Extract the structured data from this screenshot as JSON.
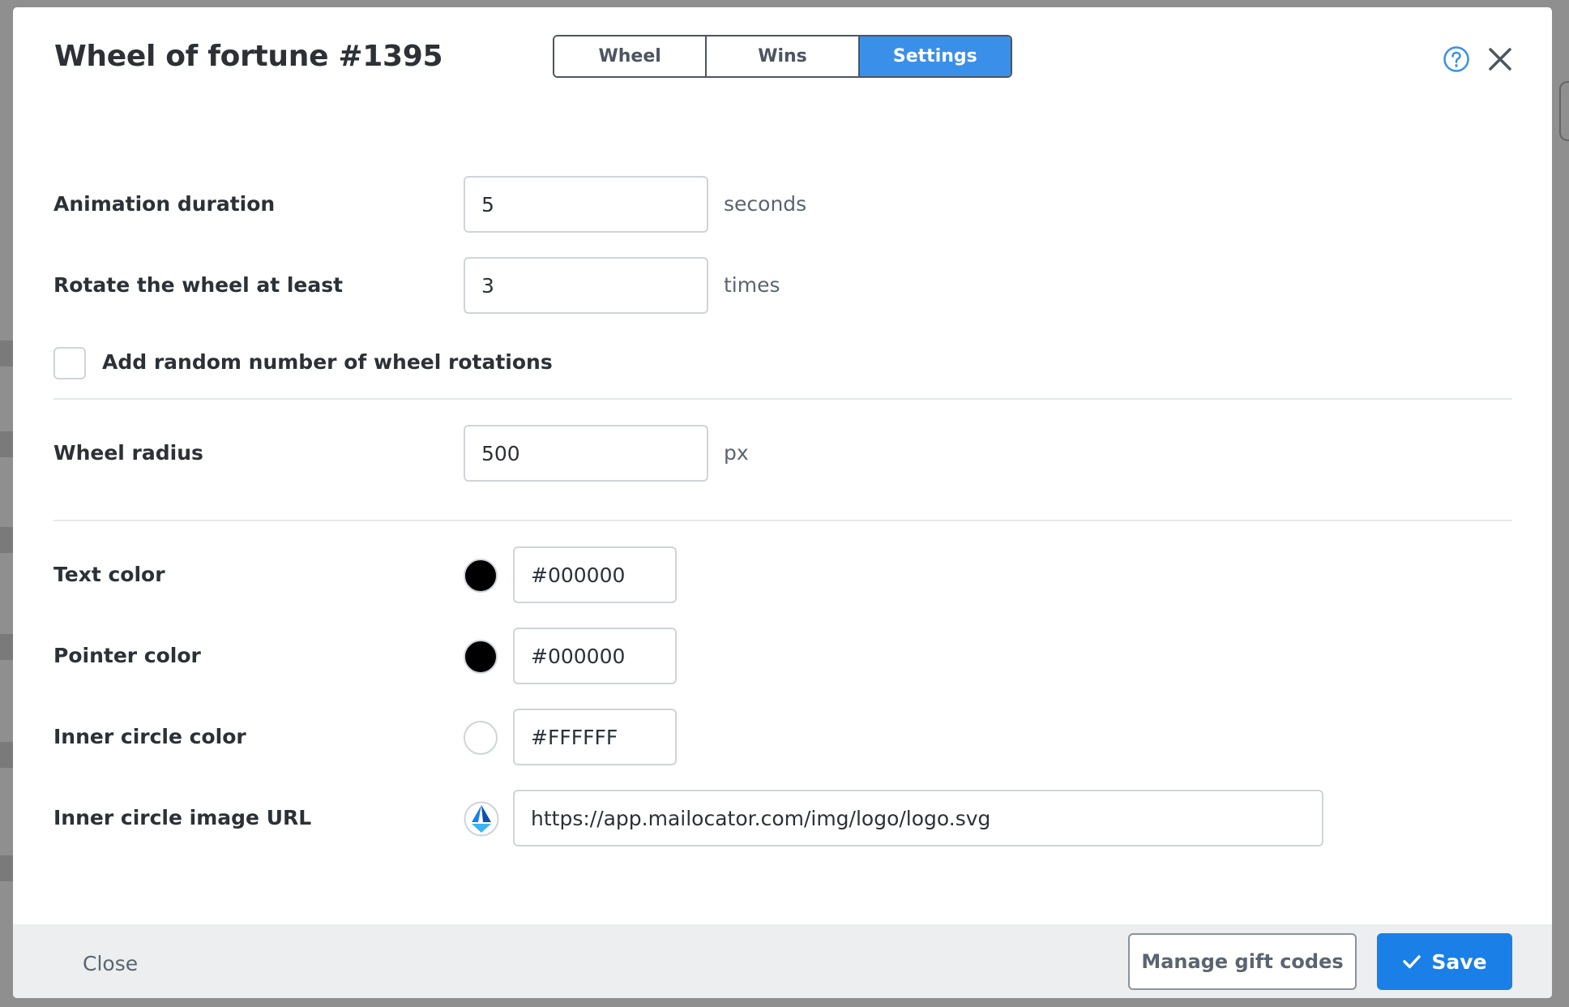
{
  "dialog": {
    "title": "Wheel of fortune #1395",
    "tabs": [
      {
        "label": "Wheel",
        "active": false
      },
      {
        "label": "Wins",
        "active": false
      },
      {
        "label": "Settings",
        "active": true
      }
    ],
    "help_icon": "question-circle-icon",
    "close_icon": "close-x-icon"
  },
  "settings": {
    "animation_duration": {
      "label": "Animation duration",
      "value": "5",
      "unit": "seconds"
    },
    "min_rotations": {
      "label": "Rotate the wheel at least",
      "value": "3",
      "unit": "times"
    },
    "random_rotations": {
      "label": "Add random number of wheel rotations",
      "checked": false
    },
    "wheel_radius": {
      "label": "Wheel radius",
      "value": "500",
      "unit": "px"
    },
    "text_color": {
      "label": "Text color",
      "value": "#000000"
    },
    "pointer_color": {
      "label": "Pointer color",
      "value": "#000000"
    },
    "inner_circle_color": {
      "label": "Inner circle color",
      "value": "#FFFFFF"
    },
    "inner_circle_image": {
      "label": "Inner circle image URL",
      "value": "https://app.mailocator.com/img/logo/logo.svg"
    }
  },
  "footer": {
    "close_label": "Close",
    "manage_label": "Manage gift codes",
    "save_label": "Save",
    "save_icon": "checkmark-icon"
  },
  "colors": {
    "accent": "#1a7fe6",
    "tab_active": "#3a8fe8",
    "footer_bg": "#eceef0"
  }
}
